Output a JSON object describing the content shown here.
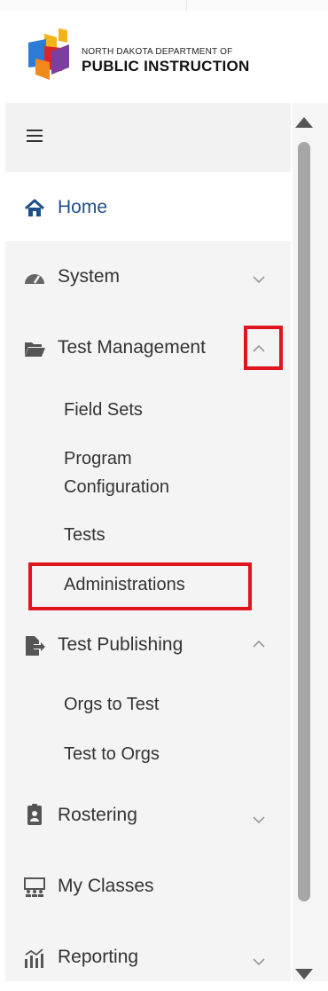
{
  "logo": {
    "line1": "North Dakota Department of",
    "line2": "Public Instruction",
    "icon": "ndpi-logo-icon"
  },
  "colors": {
    "accent": "#1f4f8a",
    "highlight": "#e0141d",
    "sidebar_bg": "#f4f4f4"
  },
  "sidebar": {
    "menu_icon": "hamburger-icon",
    "items": [
      {
        "label": "Home",
        "icon": "home-icon"
      },
      {
        "label": "System",
        "icon": "speedometer-icon",
        "chevron": "down"
      },
      {
        "label": "Test Management",
        "icon": "folder-open-icon",
        "chevron": "up",
        "subitems": [
          "Field Sets",
          "Program Configuration",
          "Tests",
          "Administrations"
        ]
      },
      {
        "label": "Test Publishing",
        "icon": "file-export-icon",
        "chevron": "up",
        "subitems": [
          "Orgs to Test",
          "Test to Orgs"
        ]
      },
      {
        "label": "Rostering",
        "icon": "clipboard-user-icon",
        "chevron": "down"
      },
      {
        "label": "My Classes",
        "icon": "classroom-icon"
      },
      {
        "label": "Reporting",
        "icon": "chart-icon",
        "chevron": "down"
      }
    ]
  }
}
